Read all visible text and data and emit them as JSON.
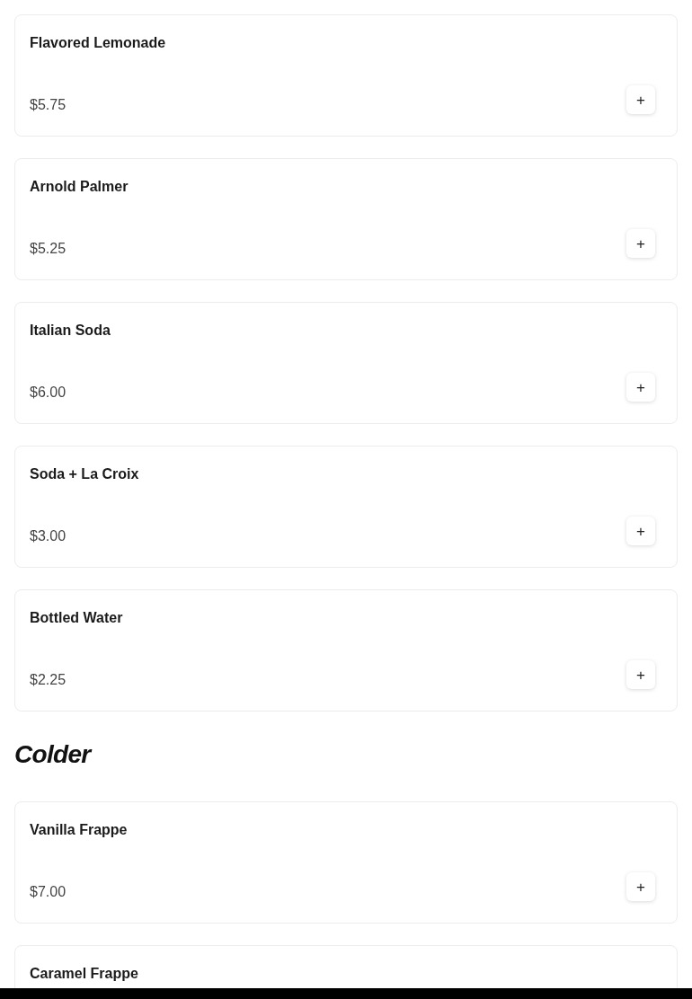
{
  "sections": [
    {
      "items": [
        {
          "name": "Flavored Lemonade",
          "price": "$5.75",
          "add_icon": "+"
        },
        {
          "name": "Arnold Palmer",
          "price": "$5.25",
          "add_icon": "+"
        },
        {
          "name": "Italian Soda",
          "price": "$6.00",
          "add_icon": "+"
        },
        {
          "name": "Soda + La Croix",
          "price": "$3.00",
          "add_icon": "+"
        },
        {
          "name": "Bottled Water",
          "price": "$2.25",
          "add_icon": "+"
        }
      ]
    },
    {
      "heading": "Colder",
      "items": [
        {
          "name": "Vanilla Frappe",
          "price": "$7.00",
          "add_icon": "+"
        },
        {
          "name": "Caramel Frappe"
        }
      ]
    }
  ]
}
